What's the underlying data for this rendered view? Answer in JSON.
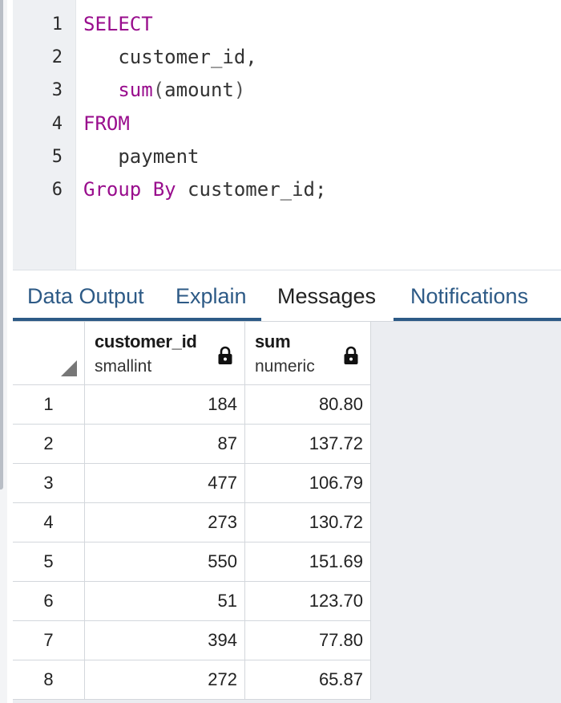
{
  "editor": {
    "lines": [
      {
        "num": "1",
        "parts": [
          {
            "cls": "kw",
            "text": "SELECT"
          }
        ]
      },
      {
        "num": "2",
        "parts": [
          {
            "cls": "plain",
            "text": "   customer_id,"
          }
        ]
      },
      {
        "num": "3",
        "parts": [
          {
            "cls": "plain",
            "text": "   "
          },
          {
            "cls": "fn",
            "text": "sum"
          },
          {
            "cls": "punct",
            "text": "("
          },
          {
            "cls": "plain",
            "text": "amount"
          },
          {
            "cls": "punct",
            "text": ")"
          }
        ]
      },
      {
        "num": "4",
        "parts": [
          {
            "cls": "kw",
            "text": "FROM"
          }
        ]
      },
      {
        "num": "5",
        "parts": [
          {
            "cls": "plain",
            "text": "   payment"
          }
        ]
      },
      {
        "num": "6",
        "parts": [
          {
            "cls": "kw",
            "text": "Group By"
          },
          {
            "cls": "plain",
            "text": " customer_id;"
          }
        ]
      }
    ]
  },
  "tabs": {
    "data_output": "Data Output",
    "explain": "Explain",
    "messages": "Messages",
    "notifications": "Notifications"
  },
  "grid": {
    "columns": [
      {
        "name": "customer_id",
        "type": "smallint"
      },
      {
        "name": "sum",
        "type": "numeric"
      }
    ],
    "rows": [
      {
        "num": "1",
        "customer_id": "184",
        "sum": "80.80"
      },
      {
        "num": "2",
        "customer_id": "87",
        "sum": "137.72"
      },
      {
        "num": "3",
        "customer_id": "477",
        "sum": "106.79"
      },
      {
        "num": "4",
        "customer_id": "273",
        "sum": "130.72"
      },
      {
        "num": "5",
        "customer_id": "550",
        "sum": "151.69"
      },
      {
        "num": "6",
        "customer_id": "51",
        "sum": "123.70"
      },
      {
        "num": "7",
        "customer_id": "394",
        "sum": "77.80"
      },
      {
        "num": "8",
        "customer_id": "272",
        "sum": "65.87"
      }
    ]
  },
  "colors": {
    "keyword": "#990d8d",
    "tab_accent": "#2d5a86"
  }
}
